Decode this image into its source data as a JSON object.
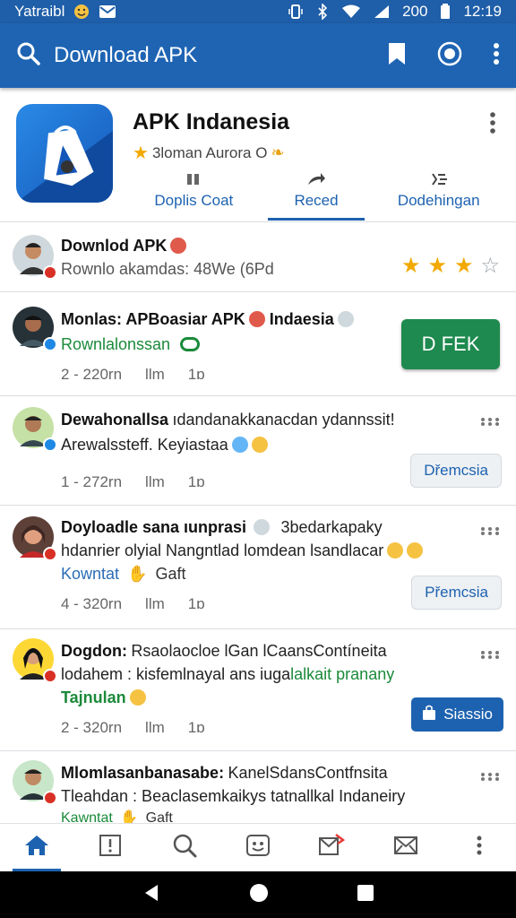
{
  "status_bar": {
    "carrier": "Yatraibl",
    "signal_text": "200",
    "time": "12:19"
  },
  "app_bar": {
    "title": "Download APK",
    "icons": [
      "search-icon",
      "bookmark-icon",
      "target-icon",
      "more-vert-icon"
    ]
  },
  "app": {
    "name": "APK Indanesia",
    "author": "3loman Aurora O",
    "tabs": [
      {
        "label": "Doplis Coat",
        "icon": "grid-icon"
      },
      {
        "label": "Reced",
        "icon": "share-icon"
      },
      {
        "label": "Dodehingan",
        "icon": "sparkle-icon"
      }
    ]
  },
  "pinned": {
    "title": "Downlod APK",
    "subtitle": "Rownlo akamdas: 48We (6Pd",
    "rating": 3,
    "max_rating": 4
  },
  "posts": [
    {
      "title": "Monlas: APBoasiar APK",
      "title_tail": "Indaesia",
      "tag": "Rownlalonssan",
      "stat_a": "2 - 220rn",
      "stat_b": "llm",
      "stat_c": "1⁠ɒ",
      "button": "D FEK"
    },
    {
      "title": "Dewahonallsa",
      "title_tail": "ıdandanakkanacdan ydannssit!",
      "line2": "Arewalssteff. Keyiastaa",
      "stat_a": "1 - 272rn",
      "stat_b": "llm",
      "stat_c": "1⁠ɒ",
      "button": "Dřemcsia"
    },
    {
      "title": "Doyloadle sana ıunprasi",
      "title_tail": "3bedarkapaky",
      "line2": "hdanrier olyial Nangntlad lomdean lsandlacar",
      "link": "Kowntat",
      "link_tail": "Gaft",
      "stat_a": "4 - 320rn",
      "stat_b": "llm",
      "stat_c": "1⁠ɒ",
      "button": "Přemcsia"
    },
    {
      "title": "Dogdon:",
      "title_tail": "Rsaolaocloe lGan lCaansContíneita",
      "line2a": "lodahem : kisfemlnayal ans iuga",
      "line2b": "lalkait pranany",
      "tag": "Tajnulan",
      "stat_a": "2 - 320rn",
      "stat_b": "llm",
      "stat_c": "1⁠ɒ",
      "button": "Siassio"
    },
    {
      "title": "Mlomlasanbanasabe:",
      "title_tail": "KanelSdansContfnsita",
      "line2": "Tleahdan : Beaclasemkaikys tatnallkal Indaneiry",
      "link": "Kawntat",
      "link_tail": "Gaft"
    }
  ],
  "bottom_nav": [
    "home-icon",
    "alert-icon",
    "search-icon",
    "face-icon",
    "send-icon",
    "mail-icon",
    "more-vert-icon"
  ],
  "colors": {
    "primary": "#1e64b3",
    "accent_green": "#1e8a4f",
    "star": "#f2a900"
  }
}
